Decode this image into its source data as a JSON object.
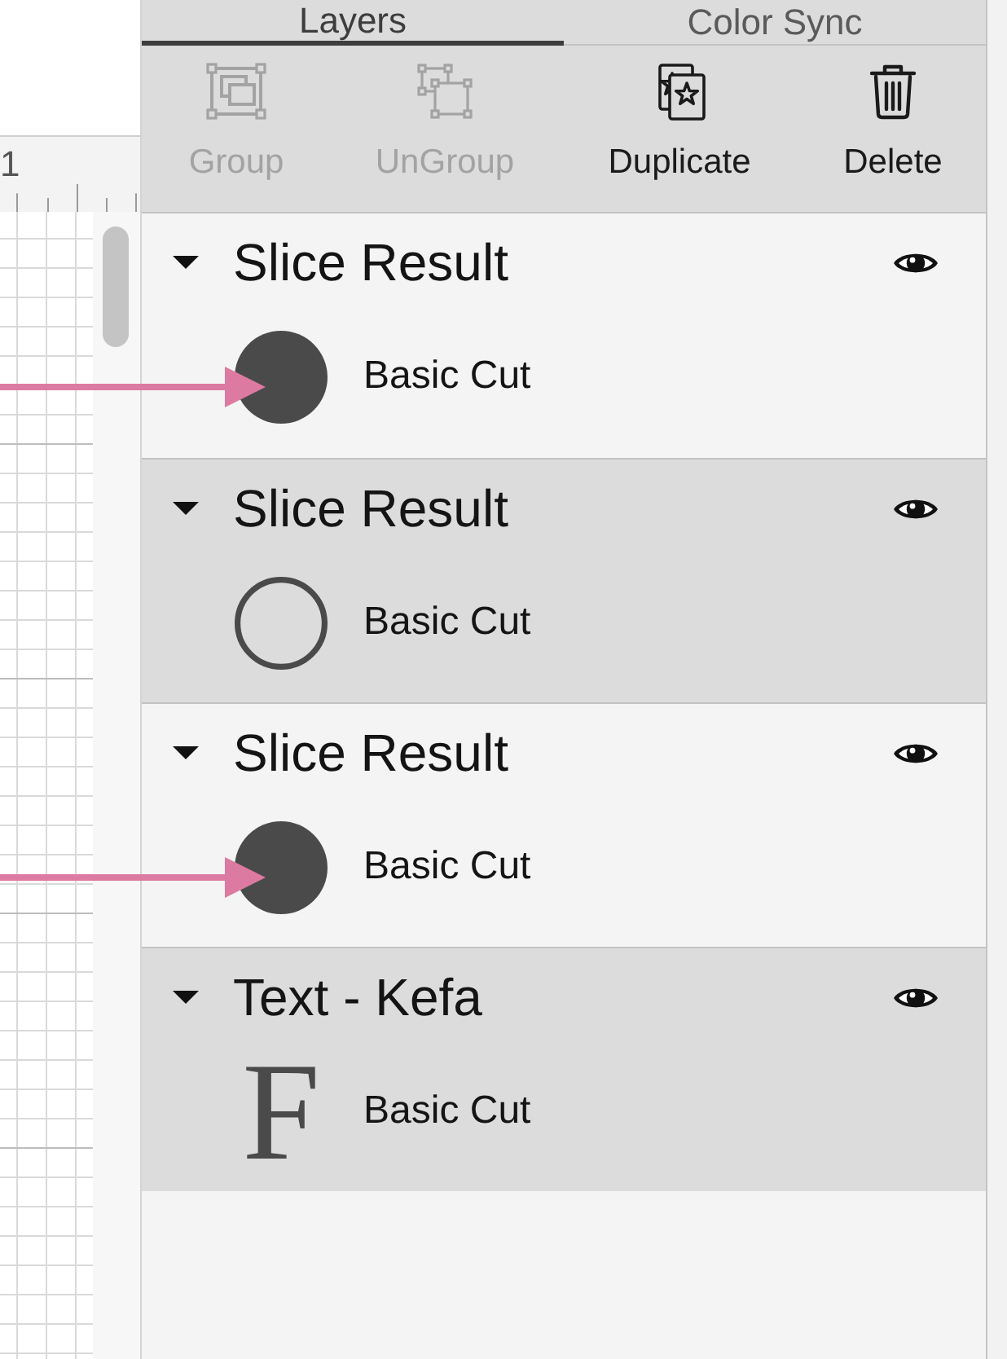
{
  "ruler": {
    "label": "1"
  },
  "tabs": [
    {
      "label": "Layers",
      "selected": true
    },
    {
      "label": "Color Sync",
      "selected": false
    }
  ],
  "toolbar": [
    {
      "kind": "group",
      "label": "Group",
      "disabled": true
    },
    {
      "kind": "ungroup",
      "label": "UnGroup",
      "disabled": true
    },
    {
      "kind": "duplicate",
      "label": "Duplicate",
      "disabled": false
    },
    {
      "kind": "delete",
      "label": "Delete",
      "disabled": false
    }
  ],
  "layers": [
    {
      "title": "Slice Result",
      "expanded": true,
      "visible": true,
      "selected": false,
      "children": [
        {
          "name": "Basic Cut",
          "thumbnail": {
            "kind": "filled-circle"
          },
          "highlight_arrow": true
        }
      ]
    },
    {
      "title": "Slice Result",
      "expanded": true,
      "visible": true,
      "selected": true,
      "children": [
        {
          "name": "Basic Cut",
          "thumbnail": {
            "kind": "outline-circle"
          },
          "highlight_arrow": false
        }
      ]
    },
    {
      "title": "Slice Result",
      "expanded": true,
      "visible": true,
      "selected": false,
      "children": [
        {
          "name": "Basic Cut",
          "thumbnail": {
            "kind": "filled-circle"
          },
          "highlight_arrow": true
        }
      ]
    },
    {
      "title": "Text - Kefa",
      "expanded": true,
      "visible": true,
      "selected": true,
      "children": [
        {
          "name": "Basic Cut",
          "thumbnail": {
            "kind": "letter",
            "text": "F"
          },
          "highlight_arrow": false
        }
      ]
    }
  ]
}
